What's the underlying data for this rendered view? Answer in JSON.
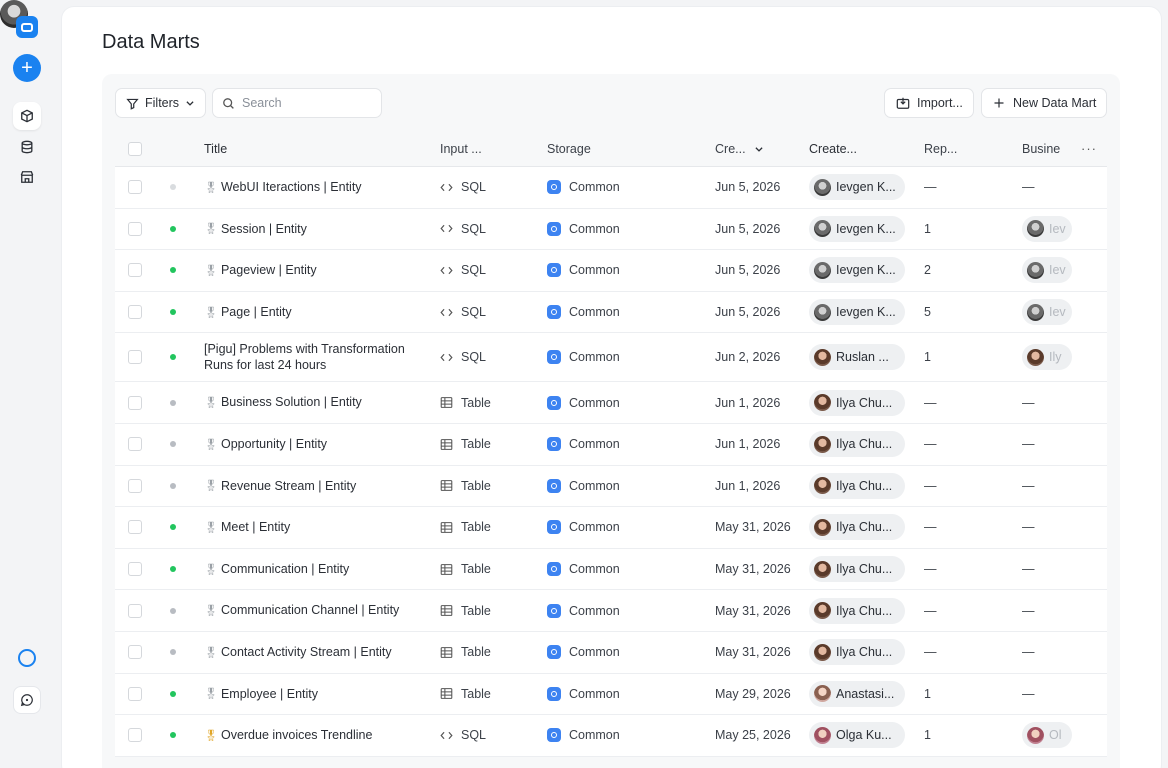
{
  "page": {
    "title": "Data Marts"
  },
  "toolbar": {
    "filters_label": "Filters",
    "search_placeholder": "Search",
    "import_label": "Import...",
    "new_label": "New Data Mart"
  },
  "columns": {
    "title": "Title",
    "input": "Input ...",
    "storage": "Storage",
    "created": "Cre...",
    "creator": "Create...",
    "reports": "Rep...",
    "business": "Busine"
  },
  "colors": {
    "accent": "#1a82f0",
    "status_active": "#22c55e",
    "status_inactive": "#b8bcc2",
    "status_draft": "#d9dcdf"
  },
  "rows": [
    {
      "status": "draft",
      "medal": "silver",
      "title": "WebUI Iteractions | Entity",
      "input": "SQL",
      "input_icon": "code-icon",
      "storage": "Common",
      "created": "Jun 5, 2026",
      "creator": "Ievgen K...",
      "creator_avatar": "av1",
      "reports": "—",
      "business": "—",
      "business_avatar": ""
    },
    {
      "status": "active",
      "medal": "silver",
      "title": "Session | Entity",
      "input": "SQL",
      "input_icon": "code-icon",
      "storage": "Common",
      "created": "Jun 5, 2026",
      "creator": "Ievgen K...",
      "creator_avatar": "av1",
      "reports": "1",
      "business": "Iev",
      "business_avatar": "av1"
    },
    {
      "status": "active",
      "medal": "silver",
      "title": "Pageview | Entity",
      "input": "SQL",
      "input_icon": "code-icon",
      "storage": "Common",
      "created": "Jun 5, 2026",
      "creator": "Ievgen K...",
      "creator_avatar": "av1",
      "reports": "2",
      "business": "Iev",
      "business_avatar": "av1"
    },
    {
      "status": "active",
      "medal": "silver",
      "title": "Page | Entity",
      "input": "SQL",
      "input_icon": "code-icon",
      "storage": "Common",
      "created": "Jun 5, 2026",
      "creator": "Ievgen K...",
      "creator_avatar": "av1",
      "reports": "5",
      "business": "Iev",
      "business_avatar": "av1"
    },
    {
      "status": "active",
      "medal": "",
      "title": "[Pigu] Problems with Transformation Runs for last 24 hours",
      "input": "SQL",
      "input_icon": "code-icon",
      "storage": "Common",
      "created": "Jun 2, 2026",
      "creator": "Ruslan ...",
      "creator_avatar": "av2",
      "reports": "1",
      "business": "Ily",
      "business_avatar": "av2",
      "tall": true
    },
    {
      "status": "inactive",
      "medal": "silver",
      "title": "Business Solution | Entity",
      "input": "Table",
      "input_icon": "table-icon",
      "storage": "Common",
      "created": "Jun 1, 2026",
      "creator": "Ilya Chu...",
      "creator_avatar": "av2",
      "reports": "—",
      "business": "—",
      "business_avatar": ""
    },
    {
      "status": "inactive",
      "medal": "silver",
      "title": "Opportunity | Entity",
      "input": "Table",
      "input_icon": "table-icon",
      "storage": "Common",
      "created": "Jun 1, 2026",
      "creator": "Ilya Chu...",
      "creator_avatar": "av2",
      "reports": "—",
      "business": "—",
      "business_avatar": ""
    },
    {
      "status": "inactive",
      "medal": "silver",
      "title": "Revenue Stream | Entity",
      "input": "Table",
      "input_icon": "table-icon",
      "storage": "Common",
      "created": "Jun 1, 2026",
      "creator": "Ilya Chu...",
      "creator_avatar": "av2",
      "reports": "—",
      "business": "—",
      "business_avatar": ""
    },
    {
      "status": "active",
      "medal": "silver",
      "title": "Meet | Entity",
      "input": "Table",
      "input_icon": "table-icon",
      "storage": "Common",
      "created": "May 31, 2026",
      "creator": "Ilya Chu...",
      "creator_avatar": "av2",
      "reports": "—",
      "business": "—",
      "business_avatar": ""
    },
    {
      "status": "active",
      "medal": "silver",
      "title": "Communication | Entity",
      "input": "Table",
      "input_icon": "table-icon",
      "storage": "Common",
      "created": "May 31, 2026",
      "creator": "Ilya Chu...",
      "creator_avatar": "av2",
      "reports": "—",
      "business": "—",
      "business_avatar": ""
    },
    {
      "status": "inactive",
      "medal": "silver",
      "title": "Communication Channel | Entity",
      "input": "Table",
      "input_icon": "table-icon",
      "storage": "Common",
      "created": "May 31, 2026",
      "creator": "Ilya Chu...",
      "creator_avatar": "av2",
      "reports": "—",
      "business": "—",
      "business_avatar": ""
    },
    {
      "status": "inactive",
      "medal": "silver",
      "title": "Contact Activity Stream | Entity",
      "input": "Table",
      "input_icon": "table-icon",
      "storage": "Common",
      "created": "May 31, 2026",
      "creator": "Ilya Chu...",
      "creator_avatar": "av2",
      "reports": "—",
      "business": "—",
      "business_avatar": ""
    },
    {
      "status": "active",
      "medal": "silver",
      "title": "Employee | Entity",
      "input": "Table",
      "input_icon": "table-icon",
      "storage": "Common",
      "created": "May 29, 2026",
      "creator": "Anastasi...",
      "creator_avatar": "av4",
      "reports": "1",
      "business": "—",
      "business_avatar": ""
    },
    {
      "status": "active",
      "medal": "gold",
      "title": "Overdue invoices Trendline",
      "input": "SQL",
      "input_icon": "code-icon",
      "storage": "Common",
      "created": "May 25, 2026",
      "creator": "Olga Ku...",
      "creator_avatar": "av3",
      "reports": "1",
      "business": "Ol",
      "business_avatar": "av3"
    }
  ]
}
